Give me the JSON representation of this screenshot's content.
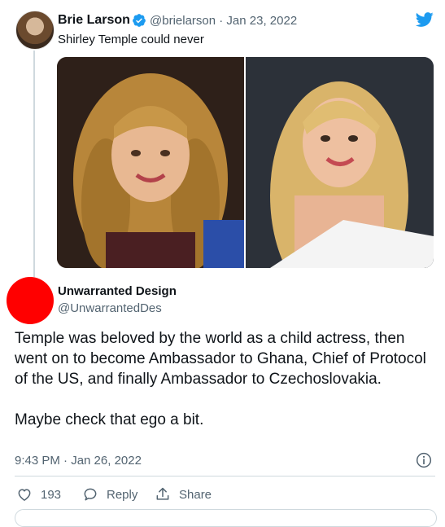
{
  "quoted": {
    "name": "Brie Larson",
    "handle_line": "@brielarson · Jan 23, 2022",
    "text": "Shirley Temple could never"
  },
  "tweet": {
    "name": "Unwarranted Design",
    "handle": "@UnwarrantedDes",
    "paragraph1": "Temple was beloved by the world as a child actress, then went on to become Ambassador to Ghana, Chief of Protocol of the US, and finally Ambassador to Czechoslovakia.",
    "paragraph2": "Maybe check that ego a bit.",
    "timestamp": "9:43 PM · Jan 26, 2022"
  },
  "actions": {
    "like_count": "193",
    "reply_label": "Reply",
    "share_label": "Share"
  },
  "colors": {
    "avatar": "#ff0000",
    "twitter_blue": "#1d9bf0",
    "muted": "#536471"
  },
  "icons": [
    "verified-badge-icon",
    "twitter-bird-icon",
    "info-icon",
    "heart-icon",
    "reply-icon",
    "share-icon"
  ]
}
